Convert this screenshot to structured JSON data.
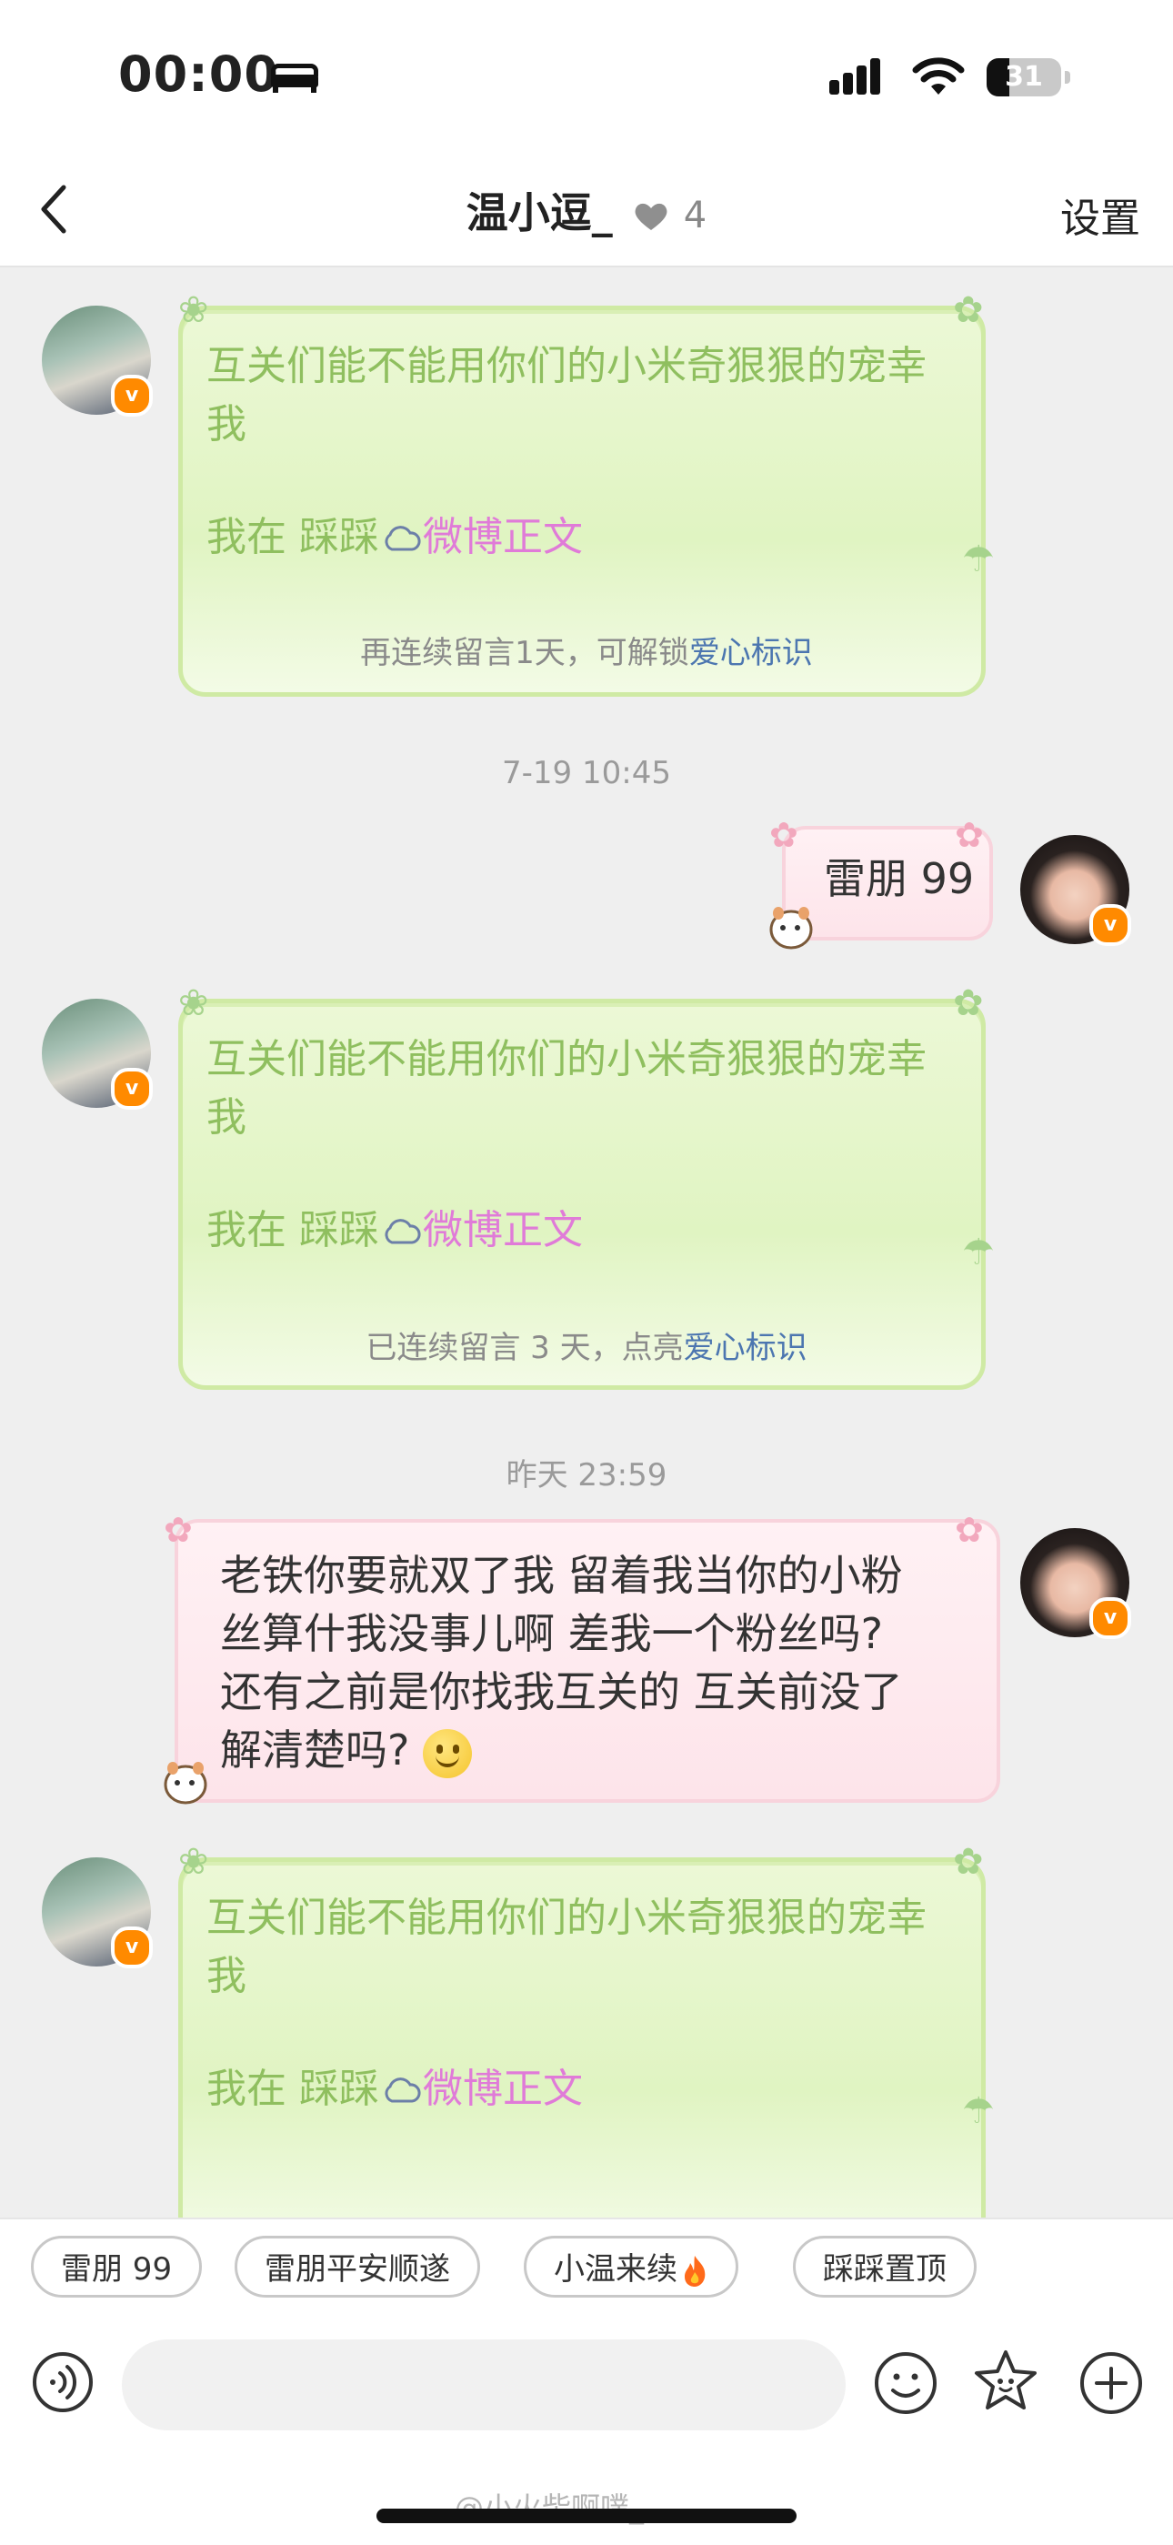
{
  "status_bar": {
    "time": "00:00",
    "battery": "31",
    "battery_fraction": 0.31
  },
  "header": {
    "title": "温小逗_",
    "heart_count": "4",
    "settings_label": "设置"
  },
  "messages": [
    {
      "line1": "互关们能不能用你们的小米奇狠狠的宠幸我",
      "line2_prefix": "我在 踩踩",
      "line2_link": "微博正文"
    },
    {
      "line1": "互关们能不能用你们的小米奇狠狠的宠幸我",
      "line2_prefix": "我在 踩踩",
      "line2_link": "微博正文"
    },
    {
      "line1": "互关们能不能用你们的小米奇狠狠的宠幸我",
      "line2_prefix": "我在 踩踩",
      "line2_link": "微博正文"
    }
  ],
  "note1": {
    "text": "再连续留言1天，可解锁",
    "link": "爱心标识"
  },
  "timestamp1": "7-19 10:45",
  "reply1": "雷朋 99",
  "note2": {
    "text": "已连续留言 3 天，点亮",
    "link": "爱心标识"
  },
  "timestamp2": "昨天 23:59",
  "reply2": {
    "lines": [
      "老铁你要就双了我 留着我当你的小粉",
      "丝算什我没事儿啊 差我一个粉丝吗?",
      "还有之前是你找我互关的 互关前没了",
      "解清楚吗?"
    ]
  },
  "quick_replies": [
    "雷朋 99",
    "雷朋平安顺遂",
    "小温来续",
    "踩踩置顶"
  ],
  "input": {
    "placeholder": ""
  },
  "watermark": "@小火柴啊噗_",
  "icons": {
    "back": "back-arrow-icon",
    "heart": "gray-heart-icon",
    "voice": "voice-icon",
    "emoji": "emoji-icon",
    "star": "star-sticker-icon",
    "plus": "plus-icon",
    "fire": "fire-icon"
  },
  "colors": {
    "green_bubble": "#e0f4c2",
    "green_text": "#8fbf5f",
    "weibo_link": "#e07bd8",
    "pink_bubble": "#fde4ea",
    "link_blue": "#4c76b0",
    "badge_orange": "#ff8a00"
  }
}
